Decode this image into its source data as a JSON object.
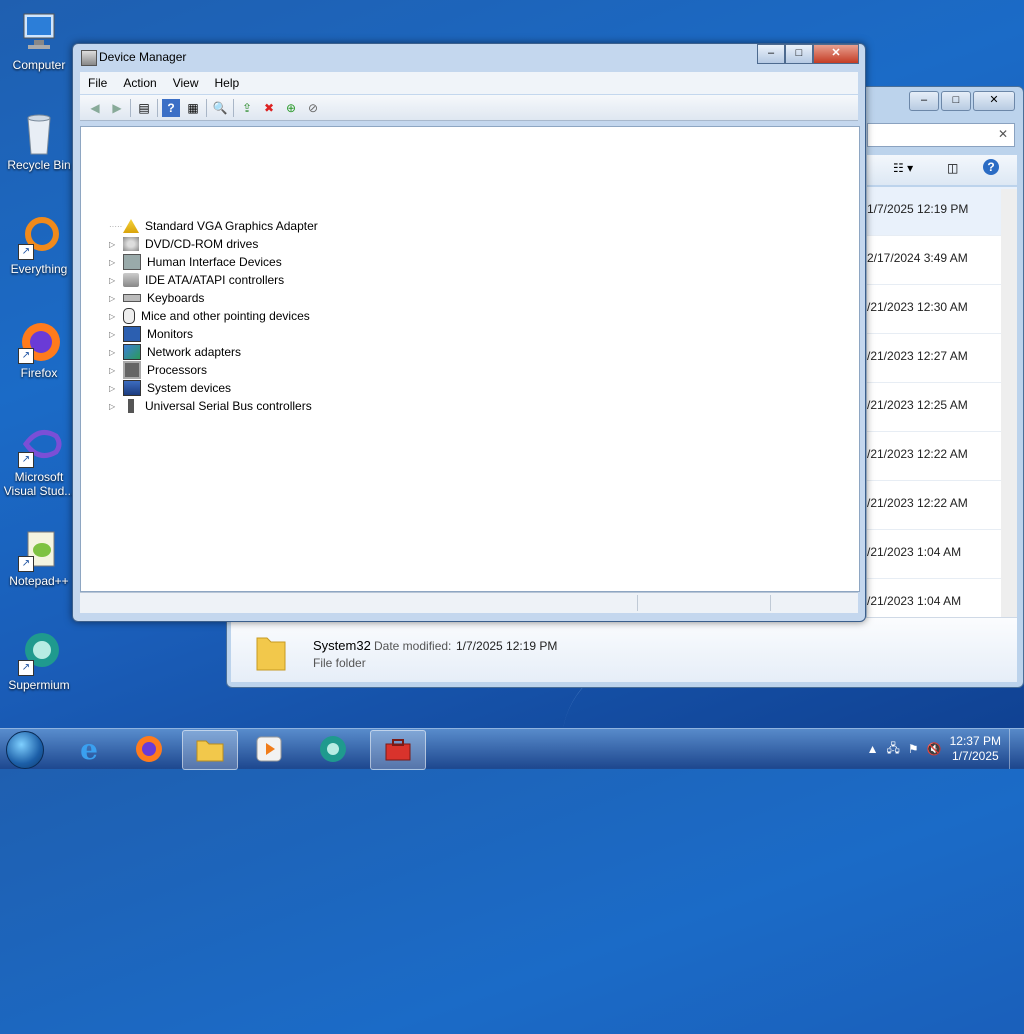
{
  "desktop": {
    "icons": [
      {
        "label": "Computer"
      },
      {
        "label": "Recycle Bin"
      },
      {
        "label": "Everything"
      },
      {
        "label": "Firefox"
      },
      {
        "label": "Microsoft Visual Stud..."
      },
      {
        "label": "Notepad++"
      },
      {
        "label": "Supermium"
      }
    ]
  },
  "explorer": {
    "list_dates": [
      "1/7/2025 12:19 PM",
      "2/17/2024 3:49 AM",
      "/21/2023 12:30 AM",
      "/21/2023 12:27 AM",
      "/21/2023 12:25 AM",
      "/21/2023 12:22 AM",
      "/21/2023 12:22 AM",
      "/21/2023 1:04 AM",
      "/21/2023 1:04 AM"
    ],
    "details": {
      "name": "System32",
      "modified_label": "Date modified:",
      "modified_value": "1/7/2025 12:19 PM",
      "type": "File folder"
    }
  },
  "device_manager": {
    "title": "Device Manager",
    "menu": [
      "File",
      "Action",
      "View",
      "Help"
    ],
    "tree": [
      {
        "label": "Standard VGA Graphics Adapter",
        "expander": false,
        "warning": true
      },
      {
        "label": "DVD/CD-ROM drives",
        "expander": true
      },
      {
        "label": "Human Interface Devices",
        "expander": true
      },
      {
        "label": "IDE ATA/ATAPI controllers",
        "expander": true
      },
      {
        "label": "Keyboards",
        "expander": true
      },
      {
        "label": "Mice and other pointing devices",
        "expander": true
      },
      {
        "label": "Monitors",
        "expander": true
      },
      {
        "label": "Network adapters",
        "expander": true
      },
      {
        "label": "Processors",
        "expander": true
      },
      {
        "label": "System devices",
        "expander": true
      },
      {
        "label": "Universal Serial Bus controllers",
        "expander": true
      }
    ]
  },
  "taskbar": {
    "clock_time": "12:37 PM",
    "clock_date": "1/7/2025"
  }
}
